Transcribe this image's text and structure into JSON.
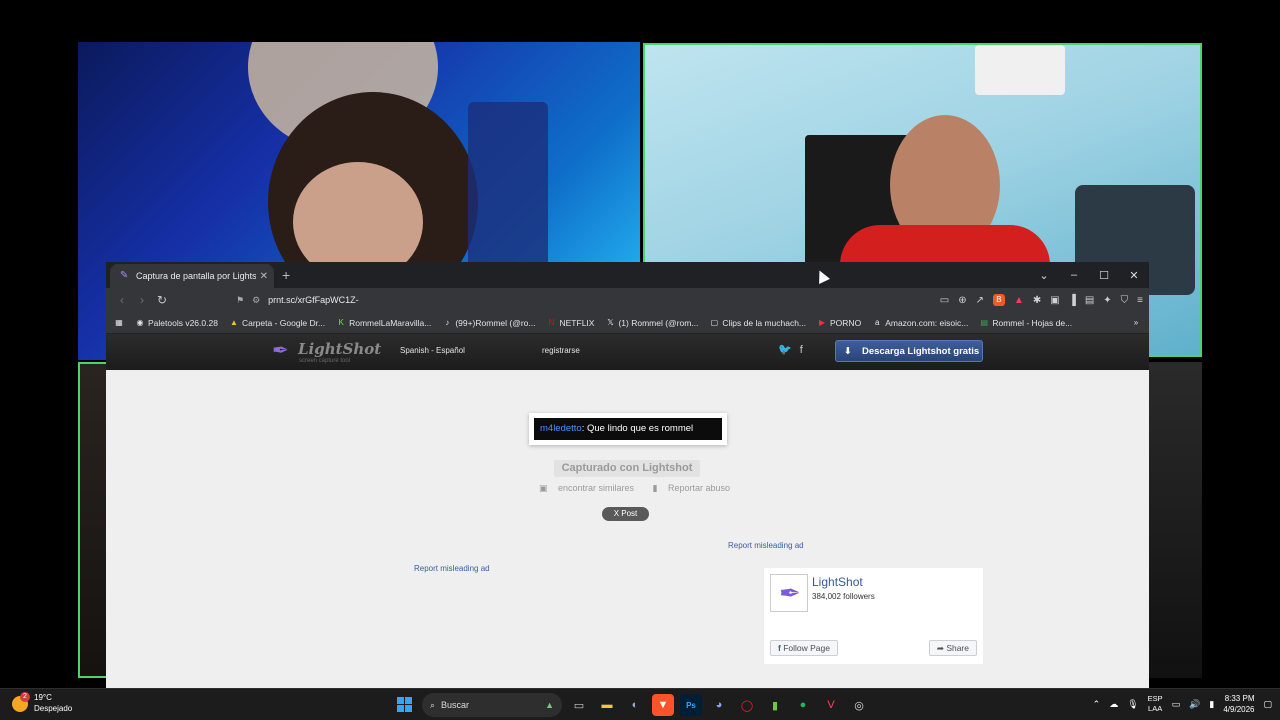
{
  "browser": {
    "tab_title": "Captura de pantalla por Lightshot",
    "url": "prnt.sc/xrGfFapWC1Z-",
    "bookmarks": [
      {
        "label": "Paletools v26.0.28"
      },
      {
        "label": "Carpeta - Google Dr..."
      },
      {
        "label": "RommelLaMaravilla..."
      },
      {
        "label": "(99+)Rommel (@ro..."
      },
      {
        "label": "NETFLIX"
      },
      {
        "label": "(1) Rommel (@rom..."
      },
      {
        "label": "Clips de la muchach..."
      },
      {
        "label": "PORNO"
      },
      {
        "label": "Amazon.com: eisoic..."
      },
      {
        "label": "Rommel - Hojas de..."
      }
    ]
  },
  "lightshot": {
    "logo_name": "LightShot",
    "logo_tagline": "screen capture tool",
    "language": "Spanish - Español",
    "register": "registrarse",
    "download_button": "Descarga Lightshot gratis",
    "screenshot_user": "m4ledetto",
    "screenshot_text": ": Que lindo que es rommel",
    "captured_label": "Capturado con Lightshot",
    "find_similar": "encontrar similares",
    "report_abuse": "Reportar abuso",
    "x_post": "X Post",
    "report_ad_right": "Report misleading ad",
    "report_ad_left": "Report misleading ad",
    "fb_page_name": "LightShot",
    "fb_followers": "384,002 followers",
    "fb_follow": "Follow Page",
    "fb_share": "Share"
  },
  "taskbar": {
    "temperature": "19°C",
    "weather_desc": "Despejado",
    "weather_badge": "2",
    "search_placeholder": "Buscar",
    "lang_line1": "ESP",
    "lang_line2": "LAA",
    "time": "8:33 PM",
    "date": "4/9/2026"
  }
}
